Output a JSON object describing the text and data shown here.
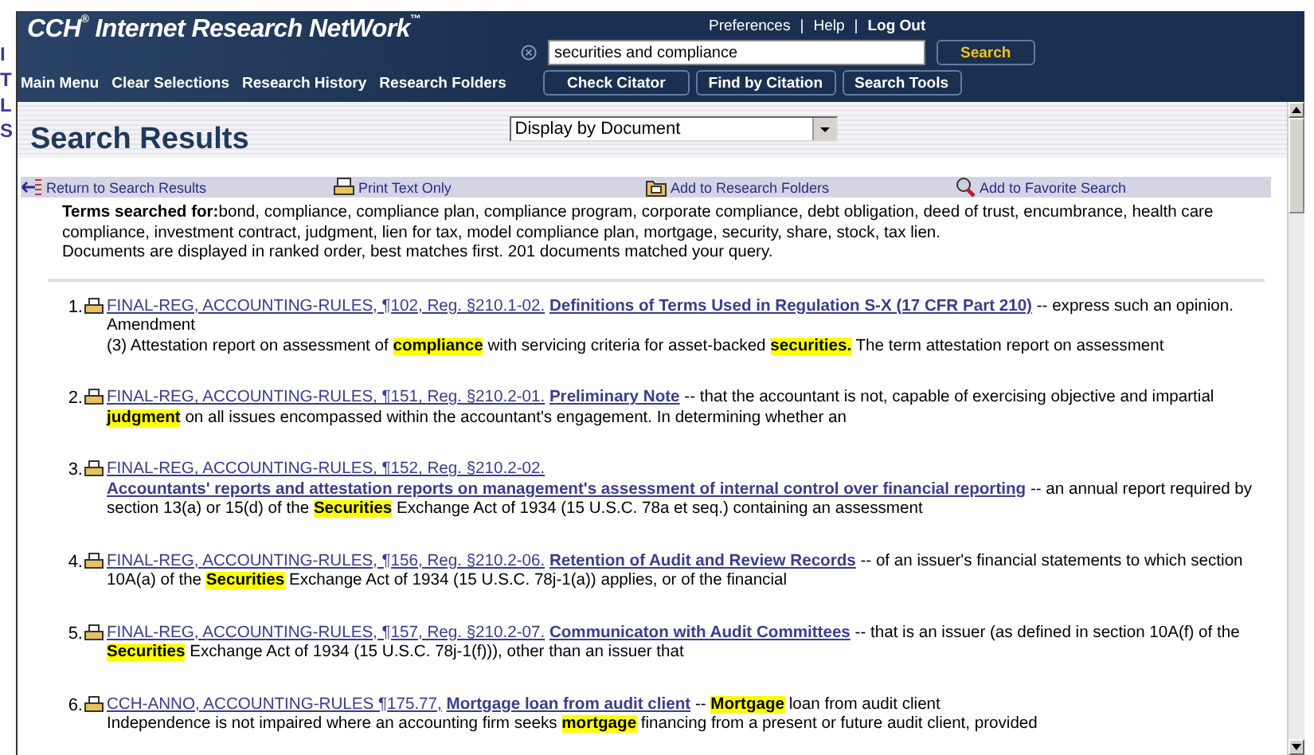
{
  "backdrop": {
    "texts": [
      "I",
      "T",
      "L",
      "S"
    ]
  },
  "header": {
    "logo": "CCH$^{®}$ Internet Research NetWork$^{™}$",
    "top_links": [
      {
        "label": "Preferences",
        "bold": false
      },
      {
        "label": "Help",
        "bold": false
      },
      {
        "label": "Log Out",
        "bold": true
      }
    ],
    "separator": "|",
    "search": {
      "value": "securities and compliance",
      "button": "Search"
    },
    "nav": [
      "Main Menu",
      "Clear Selections",
      "Research History",
      "Research Folders"
    ],
    "buttons": [
      "Check Citator",
      "Find by Citation",
      "Search Tools"
    ]
  },
  "page_title": "Search Results",
  "display_select": {
    "value": "Display by Document"
  },
  "toolbar": [
    {
      "kind": "return",
      "label": "Return to Search Results"
    },
    {
      "kind": "print",
      "label": "Print Text Only"
    },
    {
      "kind": "folder",
      "label": "Add to Research Folders"
    },
    {
      "kind": "favorite",
      "label": "Add to Favorite Search"
    }
  ],
  "terms": "**Terms searched for:**bond, compliance, compliance plan, compliance program, corporate compliance, debt obligation, deed of trust, encumbrance, health care compliance, investment contract, judgment, lien for tax, model compliance plan, mortgage, security, share, stock, tax lien.",
  "summary": "Documents are displayed in ranked order, best matches first. 201 documents matched your query.",
  "results": [
    {
      "number": "1.",
      "citation": "FINAL-REG, ACCOUNTING-RULES, ¶102, Reg. §210.1-02.",
      "title": "Definitions of Terms Used in Regulation S-X (17 CFR Part 210)",
      "snippet": "-- express such an opinion. Amendment\n(3) Attestation report on assessment of **compliance** with servicing criteria for asset-backed **securities.** The term attestation report on assessment"
    },
    {
      "number": "2.",
      "citation": "FINAL-REG, ACCOUNTING-RULES, ¶151, Reg. §210.2-01.",
      "title": "Preliminary Note",
      "snippet": "-- that the accountant is not, capable of exercising objective and impartial **judgment** on all issues encompassed within the accountant's engagement. In determining whether an"
    },
    {
      "number": "3.",
      "citation": "FINAL-REG, ACCOUNTING-RULES, ¶152, Reg. §210.2-02.",
      "title": "Accountants' reports and attestation reports on management's assessment of internal control over financial reporting",
      "snippet": "-- an annual report required by section 13(a) or 15(d) of the **Securities** Exchange Act of 1934 (15 U.S.C. 78a et seq.) containing an assessment"
    },
    {
      "number": "4.",
      "citation": "FINAL-REG, ACCOUNTING-RULES, ¶156, Reg. §210.2-06.",
      "title": "Retention of Audit and Review Records",
      "snippet": "-- of an issuer's financial statements to which section 10A(a) of the **Securities** Exchange Act of 1934 (15 U.S.C. 78j-1(a)) applies, or of the financial"
    },
    {
      "number": "5.",
      "citation": "FINAL-REG, ACCOUNTING-RULES, ¶157, Reg. §210.2-07.",
      "title": "Communicaton with Audit Committees",
      "snippet": "-- that is an issuer (as defined in section 10A(f) of the **Securities** Exchange Act of 1934 (15 U.S.C. 78j-1(f))), other than an issuer that"
    },
    {
      "number": "6.",
      "citation": "CCH-ANNO, ACCOUNTING-RULES ¶175.77,",
      "title": "Mortgage loan from audit client",
      "snippet": "-- **Mortgage** loan from audit client\nIndependence is not impaired where an accounting firm seeks **mortgage** financing from a present or future audit client, provided"
    }
  ]
}
